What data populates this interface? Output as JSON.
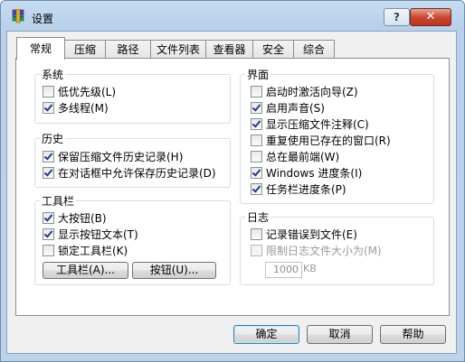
{
  "window": {
    "title": "设置",
    "help_glyph": "?",
    "close_glyph": "✕"
  },
  "tabs": [
    {
      "label": "常规",
      "active": true
    },
    {
      "label": "压缩",
      "active": false
    },
    {
      "label": "路径",
      "active": false
    },
    {
      "label": "文件列表",
      "active": false
    },
    {
      "label": "查看器",
      "active": false
    },
    {
      "label": "安全",
      "active": false
    },
    {
      "label": "综合",
      "active": false
    }
  ],
  "system_group": {
    "title": "系统",
    "items": [
      {
        "label": "低优先级(L)",
        "checked": false
      },
      {
        "label": "多线程(M)",
        "checked": true
      }
    ]
  },
  "history_group": {
    "title": "历史",
    "items": [
      {
        "label": "保留压缩文件历史记录(H)",
        "checked": true
      },
      {
        "label": "在对话框中允许保存历史记录(D)",
        "checked": true
      }
    ]
  },
  "toolbar_group": {
    "title": "工具栏",
    "items": [
      {
        "label": "大按钮(B)",
        "checked": true
      },
      {
        "label": "显示按钮文本(T)",
        "checked": true
      },
      {
        "label": "锁定工具栏(K)",
        "checked": false
      }
    ],
    "toolbar_button": "工具栏(A)...",
    "buttons_button": "按钮(U)..."
  },
  "interface_group": {
    "title": "界面",
    "items": [
      {
        "label": "启动时激活向导(Z)",
        "checked": false
      },
      {
        "label": "启用声音(S)",
        "checked": true
      },
      {
        "label": "显示压缩文件注释(C)",
        "checked": true
      },
      {
        "label": "重复使用已存在的窗口(R)",
        "checked": false
      },
      {
        "label": "总在最前端(W)",
        "checked": false
      },
      {
        "label": "Windows 进度条(I)",
        "checked": true
      },
      {
        "label": "任务栏进度条(P)",
        "checked": true
      }
    ]
  },
  "log_group": {
    "title": "日志",
    "items": [
      {
        "label": "记录错误到文件(E)",
        "checked": false,
        "disabled": false
      },
      {
        "label": "限制日志文件大小为(M)",
        "checked": false,
        "disabled": true
      }
    ],
    "limit_value": "1000",
    "limit_unit": "KB"
  },
  "footer": {
    "ok": "确定",
    "cancel": "取消",
    "help": "帮助"
  },
  "colors": {
    "frame": "#bcd3ec",
    "check": "#1f3e86",
    "close": "#c9462f"
  }
}
